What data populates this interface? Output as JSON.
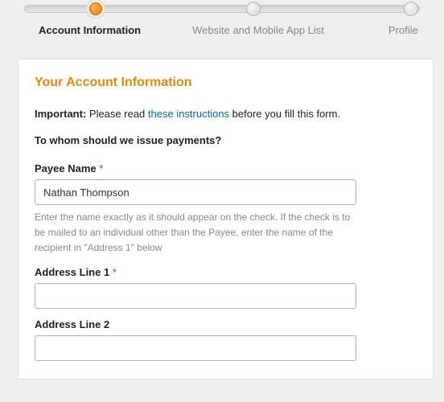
{
  "stepper": {
    "steps": [
      {
        "label": "Account Information",
        "active": true
      },
      {
        "label": "Website and Mobile App List",
        "active": false
      },
      {
        "label": "Profile",
        "active": false
      }
    ]
  },
  "card": {
    "title": "Your Account Information",
    "intro_bold": "Important:",
    "intro_before_link": " Please read ",
    "intro_link": "these instructions",
    "intro_after_link": " before you fill this form.",
    "section_label": "To whom should we issue payments?"
  },
  "fields": {
    "payee": {
      "label": "Payee Name",
      "required_marker": " *",
      "value": "Nathan Thompson",
      "help": "Enter the name exactly as it should appear on the check. If the check is to be mailed to an individual other than the Payee, enter the name of the recipient in \"Address 1\" below"
    },
    "addr1": {
      "label": "Address Line 1",
      "required_marker": " *",
      "value": ""
    },
    "addr2": {
      "label": "Address Line 2",
      "value": ""
    }
  }
}
